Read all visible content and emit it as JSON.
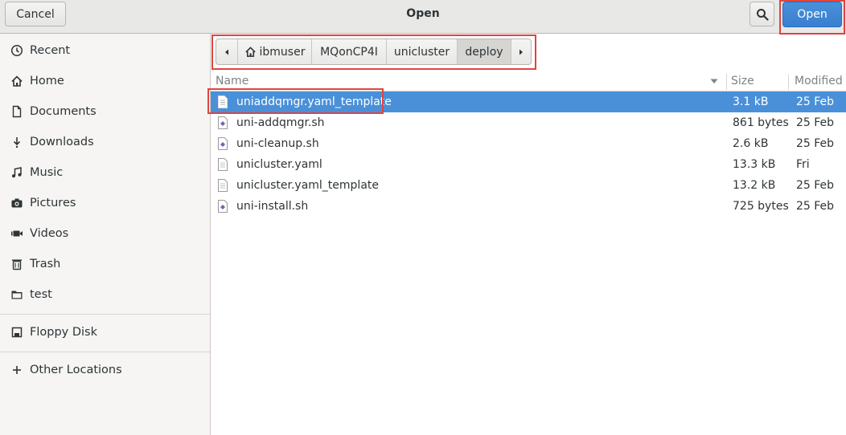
{
  "header": {
    "title": "Open",
    "cancel_label": "Cancel",
    "open_label": "Open",
    "search_icon": "search-icon"
  },
  "sidebar": {
    "items": [
      {
        "label": "Recent",
        "icon": "clock-icon"
      },
      {
        "label": "Home",
        "icon": "home-icon"
      },
      {
        "label": "Documents",
        "icon": "document-icon"
      },
      {
        "label": "Downloads",
        "icon": "download-icon"
      },
      {
        "label": "Music",
        "icon": "music-icon"
      },
      {
        "label": "Pictures",
        "icon": "camera-icon"
      },
      {
        "label": "Videos",
        "icon": "video-icon"
      },
      {
        "label": "Trash",
        "icon": "trash-icon"
      },
      {
        "label": "test",
        "icon": "folder-icon"
      }
    ],
    "devices": [
      {
        "label": "Floppy Disk",
        "icon": "floppy-icon"
      }
    ],
    "other": [
      {
        "label": "Other Locations",
        "icon": "plus-icon"
      }
    ]
  },
  "pathbar": {
    "crumbs": [
      "ibmuser",
      "MQonCP4I",
      "unicluster",
      "deploy"
    ]
  },
  "list": {
    "columns": {
      "name": "Name",
      "size": "Size",
      "modified": "Modified"
    },
    "rows": [
      {
        "name": "uniaddqmgr.yaml_template",
        "size": "3.1 kB",
        "modified": "25 Feb",
        "kind": "text"
      },
      {
        "name": "uni-addqmgr.sh",
        "size": "861 bytes",
        "modified": "25 Feb",
        "kind": "script"
      },
      {
        "name": "uni-cleanup.sh",
        "size": "2.6 kB",
        "modified": "25 Feb",
        "kind": "script"
      },
      {
        "name": "unicluster.yaml",
        "size": "13.3 kB",
        "modified": "Fri",
        "kind": "text"
      },
      {
        "name": "unicluster.yaml_template",
        "size": "13.2 kB",
        "modified": "25 Feb",
        "kind": "text"
      },
      {
        "name": "uni-install.sh",
        "size": "725 bytes",
        "modified": "25 Feb",
        "kind": "script"
      }
    ]
  },
  "colors": {
    "accent": "#4a90d9",
    "highlight": "#e0443e"
  }
}
